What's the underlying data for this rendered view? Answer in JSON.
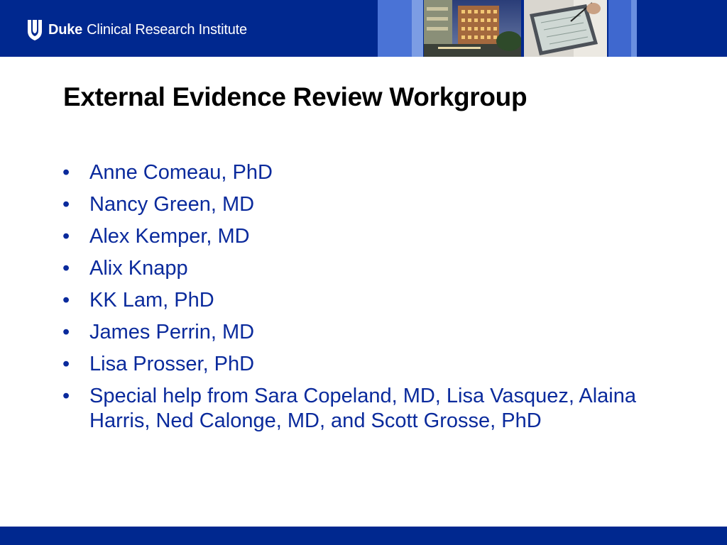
{
  "header": {
    "logo_bold": "Duke",
    "logo_rest": "Clinical Research Institute",
    "icons": [
      "duke-shield-icon"
    ],
    "photos": [
      "building-photo",
      "tablet-writing-photo"
    ]
  },
  "title": "External Evidence Review Workgroup",
  "members": [
    "Anne Comeau, PhD",
    "Nancy Green, MD",
    "Alex Kemper, MD",
    "Alix Knapp",
    "KK Lam, PhD",
    "James Perrin, MD",
    "Lisa Prosser, PhD",
    "Special help from Sara Copeland, MD, Lisa Vasquez, Alaina Harris, Ned Calonge, MD, and Scott Grosse, PhD"
  ],
  "bullet_char": "•",
  "colors": {
    "brand_blue": "#00288f",
    "text_blue": "#0a2a9c",
    "title_black": "#000000"
  }
}
